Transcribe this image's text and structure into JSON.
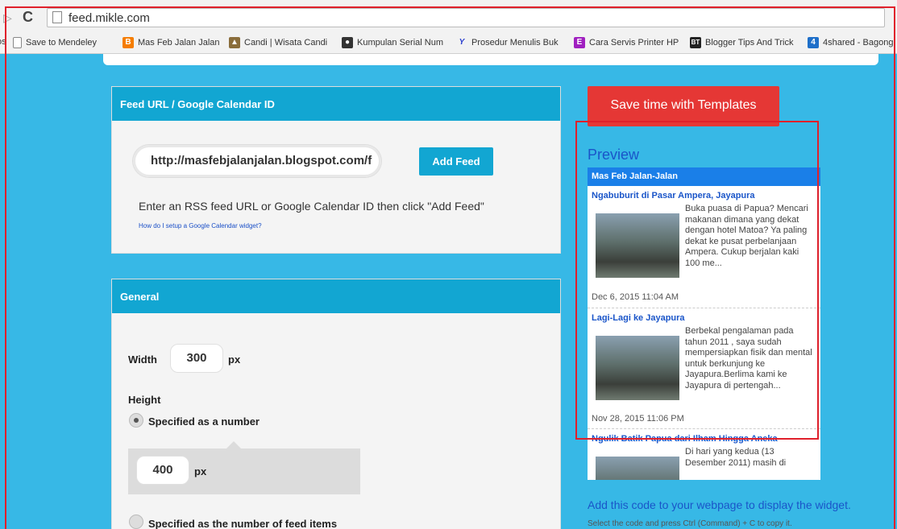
{
  "browser": {
    "url": "feed.mikle.com",
    "bookmarks": [
      {
        "label": "Save to Mendeley",
        "icon": "page-icon",
        "color": "#888888"
      },
      {
        "label": "Mas Feb Jalan Jalan",
        "icon": "blogger-icon",
        "color": "#f57d00"
      },
      {
        "label": "Candi | Wisata Candi",
        "icon": "temple-icon",
        "color": "#8a6d3b"
      },
      {
        "label": "Kumpulan Serial Num",
        "icon": "globe-icon",
        "color": "#333333"
      },
      {
        "label": "Prosedur Menulis Buk",
        "icon": "y-icon",
        "color": "#2b3fcf"
      },
      {
        "label": "Cara Servis Printer HP",
        "icon": "e-icon",
        "color": "#a020c0"
      },
      {
        "label": "Blogger Tips And Trick",
        "icon": "bt-icon",
        "color": "#222222"
      },
      {
        "label": "4shared - Bagong",
        "icon": "4shared-icon",
        "color": "#1e6fc9"
      }
    ]
  },
  "feed_section": {
    "header": "Feed URL / Google Calendar ID",
    "input_value": "http://masfebjalanjalan.blogspot.com/f",
    "add_button": "Add Feed",
    "hint": "Enter an RSS feed URL or Google Calendar ID then click \"Add Feed\"",
    "gcal_link": "How do I setup a Google Calendar widget?"
  },
  "general_section": {
    "header": "General",
    "width_label": "Width",
    "width_value": "300",
    "width_unit": "px",
    "height_label": "Height",
    "option_number": "Specified as a number",
    "height_value": "400",
    "height_unit": "px",
    "option_items": "Specified as the number of feed items"
  },
  "templates_button": "Save time with Templates",
  "preview": {
    "title": "Preview",
    "widget_title": "Mas Feb Jalan-Jalan",
    "items": [
      {
        "title": "Ngabuburit di Pasar Ampera, Jayapura",
        "desc": "Buka puasa di Papua? Mencari makanan dimana yang dekat dengan hotel Matoa? Ya paling dekat ke pusat perbelanjaan Ampera. Cukup berjalan kaki 100 me...",
        "date": "Dec 6, 2015 11:04 AM"
      },
      {
        "title": "Lagi-Lagi ke Jayapura",
        "desc": "Berbekal  pengalaman pada tahun 2011 , saya sudah mempersiapkan fisik dan mental untuk berkunjung ke Jayapura.Berlima kami ke Jayapura di pertengah...",
        "date": "Nov 28, 2015 11:06 PM"
      },
      {
        "title": "Ngulik Batik Papua dari Ilham Hingga Aneka",
        "desc": "Di hari yang kedua (13 Desember 2011) masih di",
        "date": ""
      }
    ]
  },
  "code_section": {
    "heading": "Add this code to your webpage to display the widget.",
    "hint": "Select the code and press Ctrl (Command) + C to copy it."
  }
}
